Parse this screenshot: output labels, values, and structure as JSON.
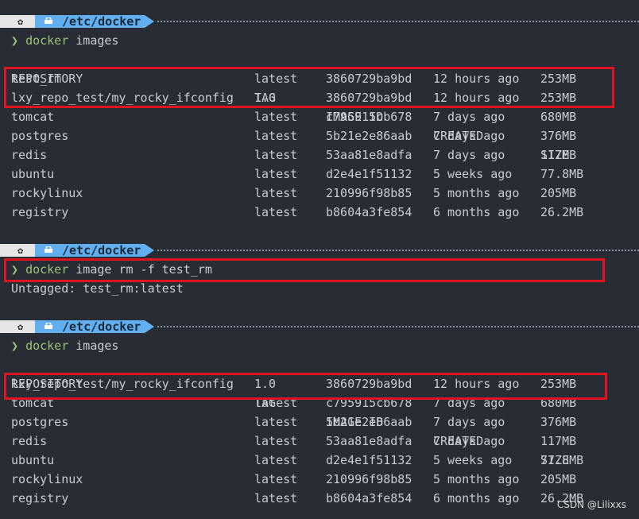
{
  "prompts": [
    {
      "path": "/etc/docker",
      "cmd": "docker",
      "args": " images"
    },
    {
      "path": "/etc/docker",
      "cmd": "docker",
      "args": " image rm -f test_rm"
    },
    {
      "path": "/etc/docker",
      "cmd": "docker",
      "args": " images"
    }
  ],
  "prompt_char": "❯",
  "headers": {
    "repo": "REPOSITORY",
    "tag": "TAG",
    "id": "IMAGE ID",
    "created": "CREATED",
    "size": "SIZE"
  },
  "table1": [
    {
      "repo": "test_rm",
      "tag": "latest",
      "id": "3860729ba9bd",
      "created": "12 hours ago",
      "size": "253MB"
    },
    {
      "repo": "lxy_repo_test/my_rocky_ifconfig",
      "tag": "1.0",
      "id": "3860729ba9bd",
      "created": "12 hours ago",
      "size": "253MB"
    },
    {
      "repo": "tomcat",
      "tag": "latest",
      "id": "c795915cb678",
      "created": "7 days ago",
      "size": "680MB"
    },
    {
      "repo": "postgres",
      "tag": "latest",
      "id": "5b21e2e86aab",
      "created": "7 days ago",
      "size": "376MB"
    },
    {
      "repo": "redis",
      "tag": "latest",
      "id": "53aa81e8adfa",
      "created": "7 days ago",
      "size": "117MB"
    },
    {
      "repo": "ubuntu",
      "tag": "latest",
      "id": "d2e4e1f51132",
      "created": "5 weeks ago",
      "size": "77.8MB"
    },
    {
      "repo": "rockylinux",
      "tag": "latest",
      "id": "210996f98b85",
      "created": "5 months ago",
      "size": "205MB"
    },
    {
      "repo": "registry",
      "tag": "latest",
      "id": "b8604a3fe854",
      "created": "6 months ago",
      "size": "26.2MB"
    }
  ],
  "untagged": "Untagged: test_rm:latest",
  "table2": [
    {
      "repo": "lxy_repo_test/my_rocky_ifconfig",
      "tag": "1.0",
      "id": "3860729ba9bd",
      "created": "12 hours ago",
      "size": "253MB"
    },
    {
      "repo": "tomcat",
      "tag": "latest",
      "id": "c795915cb678",
      "created": "7 days ago",
      "size": "680MB"
    },
    {
      "repo": "postgres",
      "tag": "latest",
      "id": "5b21e2e86aab",
      "created": "7 days ago",
      "size": "376MB"
    },
    {
      "repo": "redis",
      "tag": "latest",
      "id": "53aa81e8adfa",
      "created": "7 days ago",
      "size": "117MB"
    },
    {
      "repo": "ubuntu",
      "tag": "latest",
      "id": "d2e4e1f51132",
      "created": "5 weeks ago",
      "size": "77.8MB"
    },
    {
      "repo": "rockylinux",
      "tag": "latest",
      "id": "210996f98b85",
      "created": "5 months ago",
      "size": "205MB"
    },
    {
      "repo": "registry",
      "tag": "latest",
      "id": "b8604a3fe854",
      "created": "6 months ago",
      "size": "26.2MB"
    }
  ],
  "watermark": "CSDN @Lilixxs",
  "colors": {
    "background": "#282c34",
    "path_segment": "#61afef",
    "command": "#98c379",
    "highlight_box": "#e0141e"
  }
}
